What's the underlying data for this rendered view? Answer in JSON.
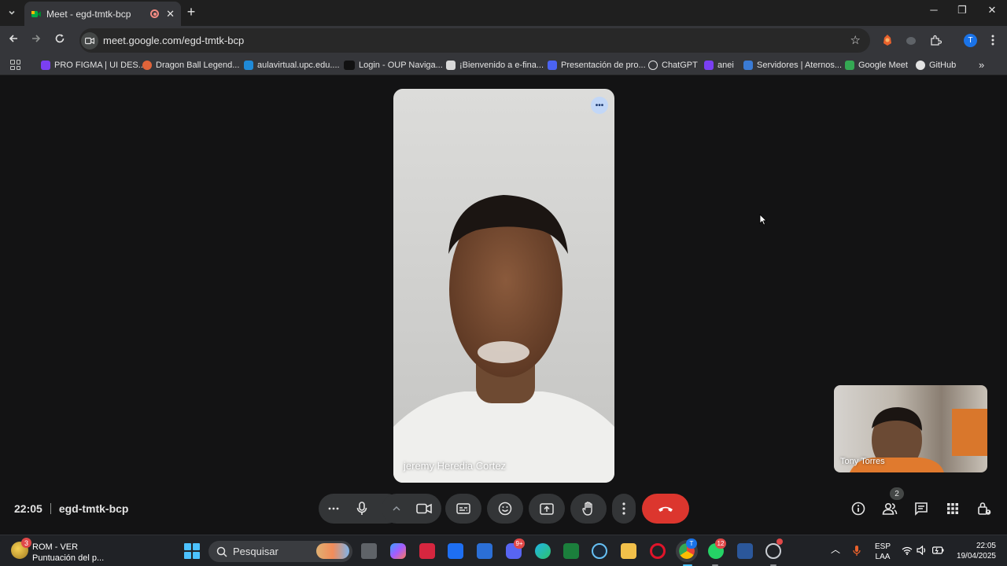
{
  "browser": {
    "tab": {
      "title": "Meet - egd-tmtk-bcp"
    },
    "url": "meet.google.com/egd-tmtk-bcp",
    "profile_initial": "T",
    "bookmarks": [
      {
        "label": "PRO FIGMA | UI DES...",
        "color": "#7b3ff2"
      },
      {
        "label": "Dragon Ball Legend...",
        "color": "#e0643a"
      },
      {
        "label": "aulavirtual.upc.edu....",
        "color": "#1f8ad8"
      },
      {
        "label": "Login - OUP Naviga...",
        "color": "#111111"
      },
      {
        "label": "¡Bienvenido a e-fina...",
        "color": "#d9d9d9"
      },
      {
        "label": "Presentación de pro...",
        "color": "#4b63f2"
      },
      {
        "label": "ChatGPT",
        "color": "#e3e3e3"
      },
      {
        "label": "anei",
        "color": "#7a3ff2"
      },
      {
        "label": "Servidores | Aternos...",
        "color": "#3a7bd5"
      },
      {
        "label": "Google Meet",
        "color": "#34a853"
      },
      {
        "label": "GitHub",
        "color": "#e3e3e3"
      }
    ]
  },
  "meet": {
    "main_participant": "jeremy Heredia Cortez",
    "self_participant": "Tony Torres",
    "time": "22:05",
    "meeting_code": "egd-tmtk-bcp",
    "participant_count": "2",
    "end_call_color": "#dc362e"
  },
  "taskbar": {
    "weather_title": "ROM - VER",
    "weather_subtitle": "Puntuación del p...",
    "weather_badge": "3",
    "search_placeholder": "Pesquisar",
    "discord_badge": "9+",
    "whatsapp_badge": "12",
    "chrome_badge": "T",
    "lang_top": "ESP",
    "lang_bottom": "LAA",
    "clock_time": "22:05",
    "clock_date": "19/04/2025"
  }
}
